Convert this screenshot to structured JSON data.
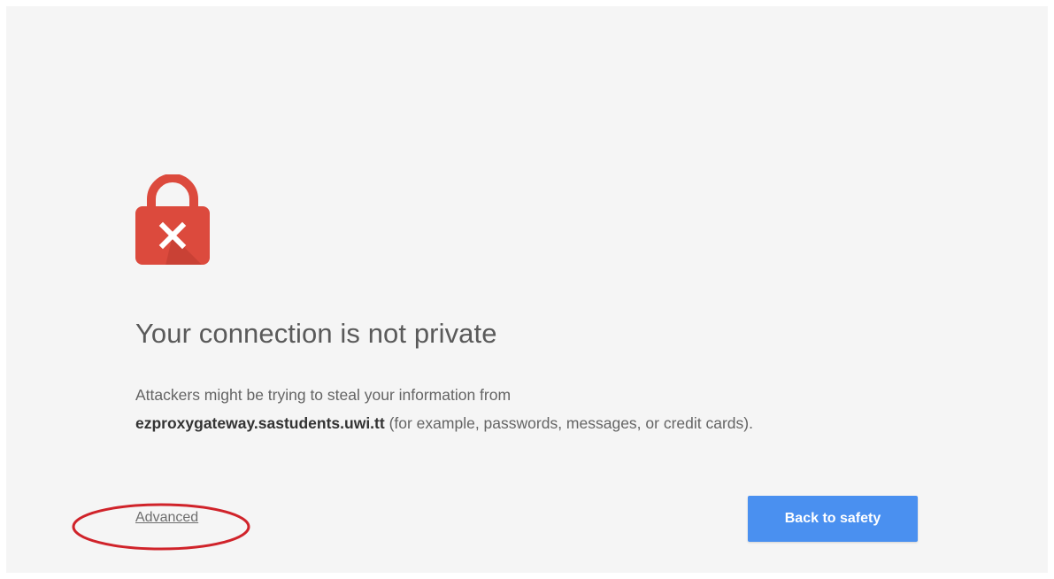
{
  "title": "Your connection is not private",
  "message": {
    "line1": "Attackers might be trying to steal your information from",
    "host": "ezproxygateway.sastudents.uwi.tt",
    "line2_rest": " (for example, passwords, messages, or credit cards)."
  },
  "advanced_label": "Advanced",
  "back_button_label": "Back to safety",
  "icon": "lock-error-icon",
  "colors": {
    "background": "#f5f5f5",
    "lock": "#dc4a3d",
    "lock_shadow": "#b93a30",
    "button": "#4a90f0",
    "annotation": "#d0232a"
  }
}
